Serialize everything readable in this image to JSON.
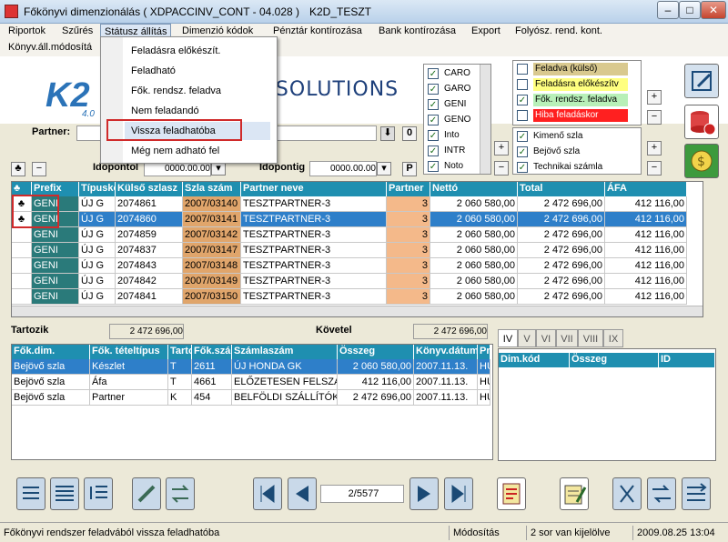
{
  "window": {
    "title": "Főkönyvi dimenzionálás ( XDPACCINV_CONT - 04.028 )",
    "db": "K2D_TESZT"
  },
  "menu": [
    "Riportok",
    "Szűrés",
    "Státusz állítás",
    "Dimenzió kódok",
    "Pénztár kontírozása",
    "Bank kontírozása",
    "Export",
    "Folyósz. rend. kont."
  ],
  "menu2": "Könyv.áll.módosítá",
  "dropdown": [
    "Feladásra előkészít.",
    "Feladható",
    "Fők. rendsz. feladva",
    "Nem feladandó",
    "Vissza feladhatóba",
    "Még nem adható fel"
  ],
  "brand": {
    "logo": "K2",
    "version": "4.0",
    "tagline": "n SOLUTIONS"
  },
  "prefix_list": [
    {
      "code": "CARO",
      "checked": true
    },
    {
      "code": "GARO",
      "checked": true
    },
    {
      "code": "GENI",
      "checked": true
    },
    {
      "code": "GENO",
      "checked": true
    },
    {
      "code": "Into",
      "checked": true
    },
    {
      "code": "INTR",
      "checked": true
    },
    {
      "code": "Noto",
      "checked": true
    }
  ],
  "status_list": [
    {
      "label": "Feladva (külső)",
      "checked": false,
      "bg": "#d9c98f"
    },
    {
      "label": "Feladásra előkészítv",
      "checked": false,
      "bg": "#ffff80"
    },
    {
      "label": "Fők. rendsz. feladva",
      "checked": true,
      "bg": "#b8f0b8"
    },
    {
      "label": "Hiba feladáskor",
      "checked": false,
      "bg": "#ff2020"
    }
  ],
  "type_list": [
    {
      "label": "Kimenő szla",
      "checked": true
    },
    {
      "label": "Bejövő szla",
      "checked": true
    },
    {
      "label": "Technikai számla",
      "checked": true
    }
  ],
  "filters": {
    "partner_label": "Partner:",
    "partner_value": "",
    "partner_count": "0",
    "idopont_from_label": "Idopontol",
    "idopont_from": "0000.00.00",
    "idopont_to_label": "Idopontig",
    "idopont_to": "0000.00.00",
    "p_label": "P"
  },
  "main_grid": {
    "columns": [
      "Prefix",
      "Típusko",
      "Külső szlasz",
      "Szla szám",
      "Partner neve",
      "Partner",
      "Nettó",
      "Total",
      "ÁFA"
    ],
    "rows": [
      [
        "GENI",
        "ÚJ G",
        "2074861",
        "2007/03140",
        "TESZTPARTNER-3",
        "3",
        "2 060 580,00",
        "2 472 696,00",
        "412 116,00"
      ],
      [
        "GENI",
        "ÚJ G",
        "2074860",
        "2007/03141",
        "TESZTPARTNER-3",
        "3",
        "2 060 580,00",
        "2 472 696,00",
        "412 116,00"
      ],
      [
        "GENI",
        "ÚJ G",
        "2074859",
        "2007/03142",
        "TESZTPARTNER-3",
        "3",
        "2 060 580,00",
        "2 472 696,00",
        "412 116,00"
      ],
      [
        "GENI",
        "ÚJ G",
        "2074837",
        "2007/03147",
        "TESZTPARTNER-3",
        "3",
        "2 060 580,00",
        "2 472 696,00",
        "412 116,00"
      ],
      [
        "GENI",
        "ÚJ G",
        "2074843",
        "2007/03148",
        "TESZTPARTNER-3",
        "3",
        "2 060 580,00",
        "2 472 696,00",
        "412 116,00"
      ],
      [
        "GENI",
        "ÚJ G",
        "2074842",
        "2007/03149",
        "TESZTPARTNER-3",
        "3",
        "2 060 580,00",
        "2 472 696,00",
        "412 116,00"
      ],
      [
        "GENI",
        "ÚJ G",
        "2074841",
        "2007/03150",
        "TESZTPARTNER-3",
        "3",
        "2 060 580,00",
        "2 472 696,00",
        "412 116,00"
      ]
    ]
  },
  "totals": {
    "tartozik_label": "Tartozik",
    "tartozik": "2 472 696,00",
    "kovetel_label": "Követel",
    "kovetel": "2 472 696,00"
  },
  "sub_grid": {
    "columns": [
      "Fők.dim.",
      "Fők. tételtípus",
      "Tarto",
      "Fők.szá",
      "Számlaszám",
      "Összeg",
      "Könyv.dátum",
      "Pr"
    ],
    "rows": [
      [
        "Bejövő szla",
        "Készlet",
        "T",
        "2611",
        "ÚJ HONDA GK",
        "2 060 580,00",
        "2007.11.13.",
        "HU"
      ],
      [
        "Bejövő szla",
        "Áfa",
        "T",
        "4661",
        "ELŐZETESEN FELSZÁM",
        "412 116,00",
        "2007.11.13.",
        "HU"
      ],
      [
        "Bejövő szla",
        "Partner",
        "K",
        "454",
        "BELFÖLDI SZÁLLÍTÓK",
        "2 472 696,00",
        "2007.11.13.",
        "HU"
      ]
    ]
  },
  "dim_tabs": [
    "IV",
    "V",
    "VI",
    "VII",
    "VIII",
    "IX"
  ],
  "dim_grid": {
    "columns": [
      "Dim.kód",
      "Összeg",
      "ID"
    ]
  },
  "pager": "2/5577",
  "status": {
    "message": "Főkönyvi rendszer feladvából vissza feladhatóba",
    "mode": "Módosítás",
    "selection": "2 sor van kijelölve",
    "datetime": "2009.08.25 13:04"
  }
}
